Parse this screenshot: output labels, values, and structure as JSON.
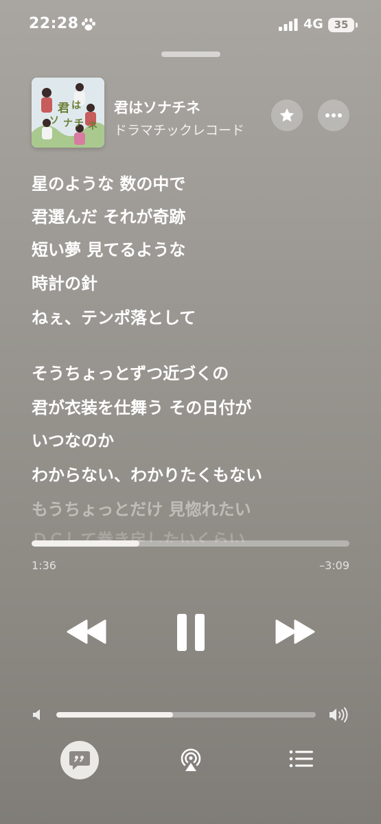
{
  "status_bar": {
    "time": "22:28",
    "network": "4G",
    "battery": "35",
    "icons": [
      "paw-icon",
      "signal-bars-icon"
    ]
  },
  "track": {
    "title": "君はソナチネ",
    "artist": "ドラマチックレコード",
    "artwork_text": [
      "君",
      "は",
      "ソ",
      "ナ",
      "チ",
      "ネ"
    ]
  },
  "lyrics": [
    "星のような 数の中で",
    "君選んだ それが奇跡",
    "短い夢 見てるような",
    "時計の針",
    "ねぇ、テンポ落として",
    "そうちょっとずつ近づくの",
    "君が衣装を仕舞う その日付が",
    "いつなのか",
    "わからない、わかりたくもない",
    "もうちょっとだけ 見惚れたい",
    "ＤＣして巻き戻したいくらい"
  ],
  "playback": {
    "elapsed": "1:36",
    "remaining": "–3:09",
    "progress_fraction": 0.34
  },
  "volume": {
    "level_fraction": 0.45
  },
  "colors": {
    "background_top": "#a9a6a1",
    "background_bottom": "#807d78",
    "foreground": "#ffffff"
  },
  "controls": {
    "icons": [
      "star-icon",
      "more-icon",
      "rewind-icon",
      "pause-icon",
      "fast-forward-icon",
      "speaker-low-icon",
      "speaker-high-icon",
      "lyrics-quote-icon",
      "airplay-icon",
      "queue-list-icon"
    ]
  }
}
